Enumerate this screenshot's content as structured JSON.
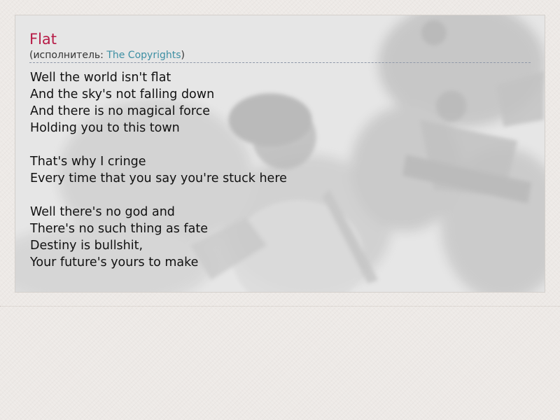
{
  "song": {
    "title": "Flat",
    "artist_prefix": "(исполнитель: ",
    "artist_name": "The Copyrights",
    "artist_suffix": ")"
  },
  "lyrics": [
    "Well the world isn't flat",
    "And the sky's not falling down",
    "And there is no magical force",
    "Holding you to this town",
    "",
    "That's why I cringe",
    "Every time that you say you're stuck here",
    "",
    "Well there's no god and",
    "There's no such thing as fate",
    "Destiny is bullshit,",
    "Your future's yours to make"
  ],
  "colors": {
    "title": "#b71c47",
    "link": "#3d8fa3",
    "card_background": "#e4e4e4",
    "page_background": "#ede9e6"
  }
}
